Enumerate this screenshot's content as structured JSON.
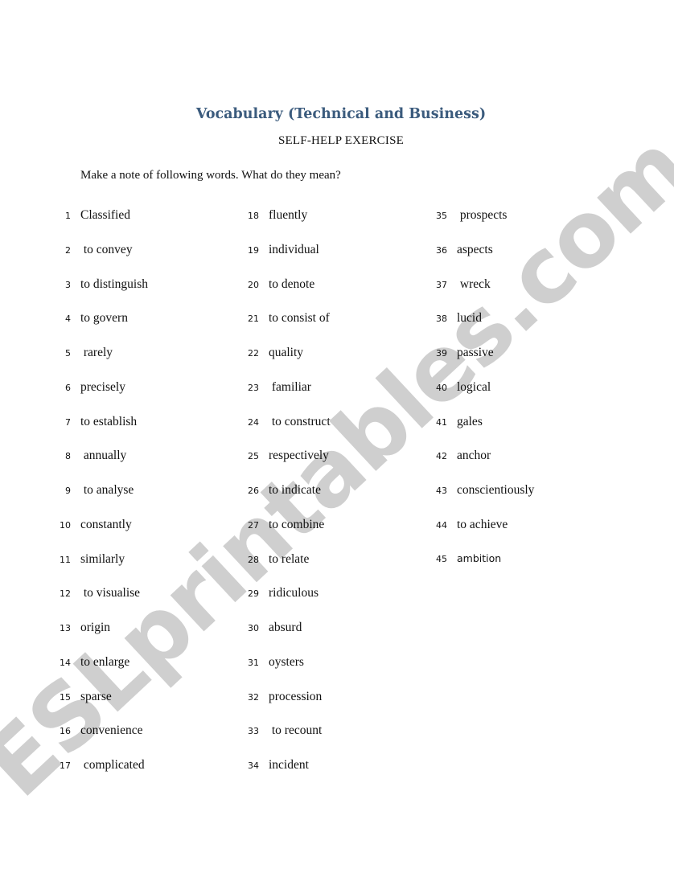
{
  "document": {
    "title": "Vocabulary (Technical and Business)",
    "subtitle": "SELF-HELP EXERCISE",
    "instruction": "Make a note of following words. What do they mean?",
    "watermark": "ESLprintables.com",
    "title_color": "#3b5b7d",
    "watermark_color": "#cfcfcf"
  },
  "columns": [
    {
      "items": [
        {
          "number": "1",
          "word": "Classified"
        },
        {
          "number": "2",
          "word": " to convey"
        },
        {
          "number": "3",
          "word": "to distinguish"
        },
        {
          "number": "4",
          "word": "to govern"
        },
        {
          "number": "5",
          "word": " rarely"
        },
        {
          "number": "6",
          "word": "precisely"
        },
        {
          "number": "7",
          "word": "to establish"
        },
        {
          "number": "8",
          "word": " annually"
        },
        {
          "number": "9",
          "word": " to analyse"
        },
        {
          "number": "10",
          "word": "constantly"
        },
        {
          "number": "11",
          "word": "similarly"
        },
        {
          "number": "12",
          "word": " to visualise"
        },
        {
          "number": "13",
          "word": "origin"
        },
        {
          "number": "14",
          "word": "to enlarge"
        },
        {
          "number": "15",
          "word": "sparse"
        },
        {
          "number": "16",
          "word": "convenience"
        },
        {
          "number": "17",
          "word": " complicated"
        }
      ]
    },
    {
      "items": [
        {
          "number": "18",
          "word": "fluently"
        },
        {
          "number": "19",
          "word": "individual"
        },
        {
          "number": "20",
          "word": "to denote"
        },
        {
          "number": "21",
          "word": "to consist of"
        },
        {
          "number": "22",
          "word": "quality"
        },
        {
          "number": "23",
          "word": " familiar"
        },
        {
          "number": "24",
          "word": " to construct"
        },
        {
          "number": "25",
          "word": "respectively"
        },
        {
          "number": "26",
          "word": "to indicate"
        },
        {
          "number": "27",
          "word": "to combine"
        },
        {
          "number": "28",
          "word": "to relate"
        },
        {
          "number": "29",
          "word": "ridiculous"
        },
        {
          "number": "30",
          "word": "absurd"
        },
        {
          "number": "31",
          "word": "oysters"
        },
        {
          "number": "32",
          "word": "procession"
        },
        {
          "number": "33",
          "word": " to recount"
        },
        {
          "number": "34",
          "word": "incident"
        }
      ]
    },
    {
      "items": [
        {
          "number": "35",
          "word": " prospects"
        },
        {
          "number": "36",
          "word": "aspects"
        },
        {
          "number": "37",
          "word": " wreck"
        },
        {
          "number": "38",
          "word": "lucid"
        },
        {
          "number": "39",
          "word": "passive"
        },
        {
          "number": "40",
          "word": "logical"
        },
        {
          "number": "41",
          "word": "gales"
        },
        {
          "number": "42",
          "word": "anchor"
        },
        {
          "number": "43",
          "word": "conscientiously"
        },
        {
          "number": "44",
          "word": "to achieve"
        },
        {
          "number": "45",
          "word": "ambition",
          "style": "sans"
        }
      ]
    }
  ]
}
